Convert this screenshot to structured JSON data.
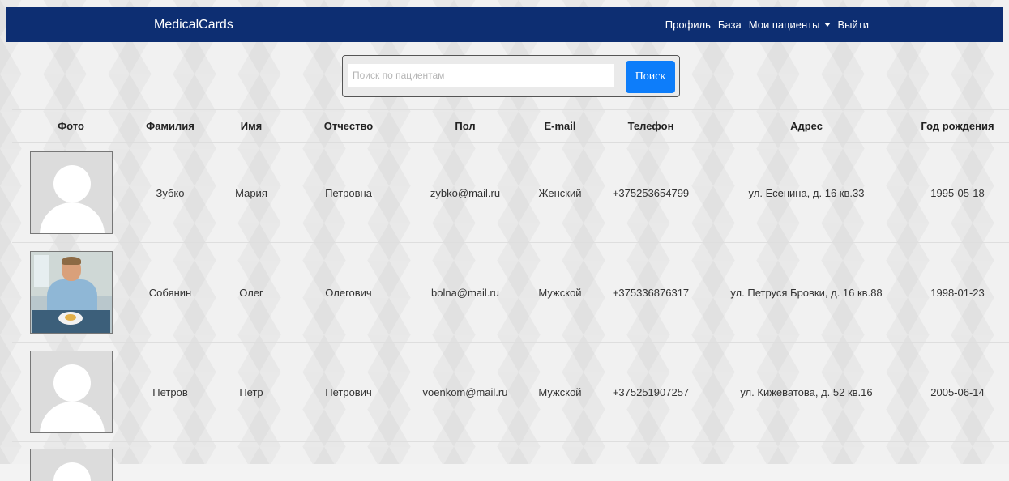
{
  "navbar": {
    "brand": "MedicalCards",
    "links": {
      "profile": "Профиль",
      "base": "База",
      "my_patients": "Мои пациенты",
      "logout": "Выйти"
    },
    "color": "#0d2e72"
  },
  "search": {
    "placeholder": "Поиск по пациентам",
    "value": "",
    "button_label": "Поиск",
    "button_color": "#0d7dfa"
  },
  "table": {
    "headers": [
      "Фото",
      "Фамилия",
      "Имя",
      "Отчество",
      "Пол",
      "E-mail",
      "Телефон",
      "Адрес",
      "Год рождения"
    ],
    "rows": [
      {
        "photo": "default-avatar",
        "last_name": "Зубко",
        "first_name": "Мария",
        "patronymic": "Петровна",
        "email": "zybko@mail.ru",
        "gender": "Женский",
        "phone": "+375253654799",
        "address": "ул. Есенина, д. 16 кв.33",
        "birth_year": "1995-05-18"
      },
      {
        "photo": "patient-photo",
        "last_name": "Собянин",
        "first_name": "Олег",
        "patronymic": "Олегович",
        "email": "bolna@mail.ru",
        "gender": "Мужской",
        "phone": "+375336876317",
        "address": "ул. Петруся Бровки, д. 16 кв.88",
        "birth_year": "1998-01-23"
      },
      {
        "photo": "default-avatar",
        "last_name": "Петров",
        "first_name": "Петр",
        "patronymic": "Петрович",
        "email": "voenkom@mail.ru",
        "gender": "Мужской",
        "phone": "+375251907257",
        "address": "ул. Кижеватова, д. 52 кв.16",
        "birth_year": "2005-06-14"
      }
    ]
  }
}
